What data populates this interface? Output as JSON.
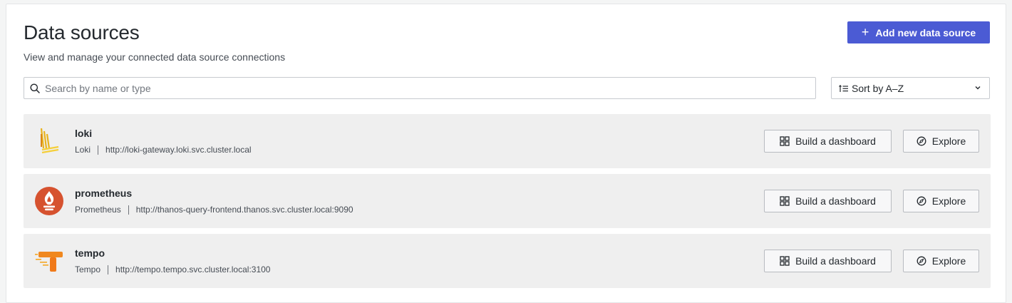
{
  "page": {
    "title": "Data sources",
    "subtitle": "View and manage your connected data source connections"
  },
  "header": {
    "add_button_label": "Add new data source",
    "add_icon": "plus-icon"
  },
  "search": {
    "placeholder": "Search by name or type",
    "value": ""
  },
  "sort": {
    "selected": "Sort by A–Z"
  },
  "colors": {
    "primary": "#4b5bd4",
    "row_bg": "#efefef",
    "loki_yellow": "#f5c518",
    "prometheus_red": "#d6522f",
    "tempo_orange": "#f07a1a"
  },
  "datasources": [
    {
      "name": "loki",
      "type": "Loki",
      "url": "http://loki-gateway.loki.svc.cluster.local",
      "logo": "loki-logo",
      "build_label": "Build a dashboard",
      "explore_label": "Explore"
    },
    {
      "name": "prometheus",
      "type": "Prometheus",
      "url": "http://thanos-query-frontend.thanos.svc.cluster.local:9090",
      "logo": "prometheus-logo",
      "build_label": "Build a dashboard",
      "explore_label": "Explore"
    },
    {
      "name": "tempo",
      "type": "Tempo",
      "url": "http://tempo.tempo.svc.cluster.local:3100",
      "logo": "tempo-logo",
      "build_label": "Build a dashboard",
      "explore_label": "Explore"
    }
  ]
}
